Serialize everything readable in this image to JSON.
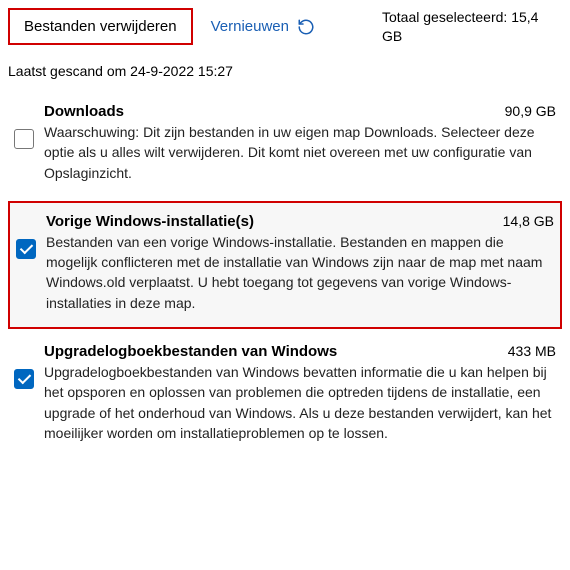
{
  "toolbar": {
    "delete_label": "Bestanden verwijderen",
    "refresh_label": "Vernieuwen"
  },
  "summary": {
    "total_selected_label": "Totaal geselecteerd:",
    "total_selected_value": "15,4 GB",
    "last_scanned": "Laatst gescand om 24-9-2022 15:27"
  },
  "items": [
    {
      "title": "Downloads",
      "size": "90,9 GB",
      "description": "Waarschuwing: Dit zijn bestanden in uw eigen map Downloads. Selecteer deze optie als u alles wilt verwijderen. Dit komt niet overeen met uw configuratie van Opslaginzicht."
    },
    {
      "title": "Vorige Windows-installatie(s)",
      "size": "14,8 GB",
      "description": "Bestanden van een vorige Windows-installatie. Bestanden en mappen die mogelijk conflicteren met de installatie van Windows zijn naar de map met naam Windows.old verplaatst. U hebt toegang tot gegevens van vorige Windows-installaties in deze map."
    },
    {
      "title": "Upgradelogboekbestanden van Windows",
      "size": "433 MB",
      "description": "Upgradelogboekbestanden van Windows bevatten informatie die u kan helpen bij het opsporen en oplossen van problemen die optreden tijdens de installatie, een upgrade of het onderhoud van Windows. Als u deze bestanden verwijdert, kan het moeilijker worden om installatieproblemen op te lossen."
    }
  ]
}
